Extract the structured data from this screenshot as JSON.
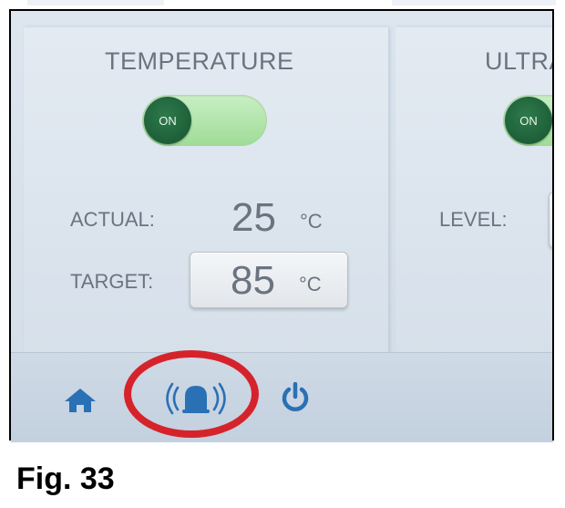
{
  "temperature": {
    "title": "TEMPERATURE",
    "toggle_label": "ON",
    "actual_label": "ACTUAL:",
    "actual_value": "25",
    "actual_unit": "°C",
    "target_label": "TARGET:",
    "target_value": "85",
    "target_unit": "°C"
  },
  "ultrasound": {
    "title": "ULTRA",
    "toggle_label": "ON",
    "level_label": "LEVEL:"
  },
  "bottom_bar": {
    "icons": [
      "home-icon",
      "alarm-bell-icon",
      "power-icon"
    ],
    "highlight_color": "#d6232b"
  },
  "caption": "Fig. 33"
}
